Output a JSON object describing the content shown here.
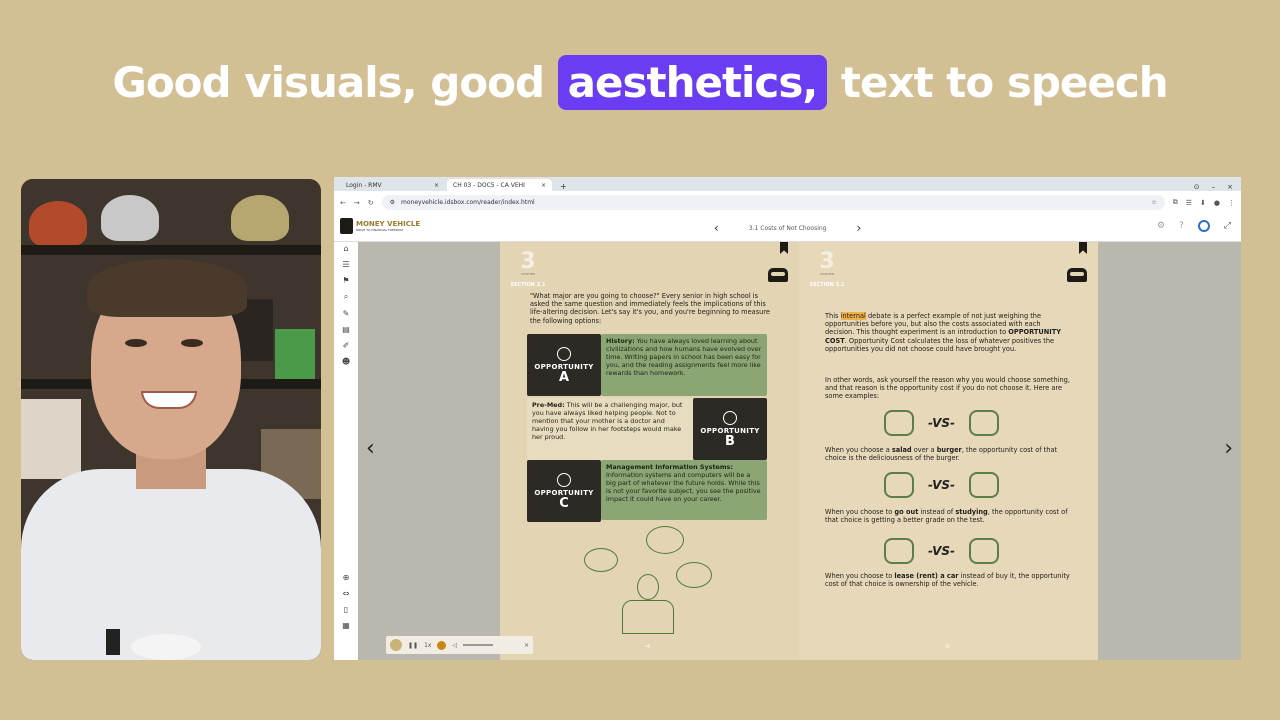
{
  "headline": {
    "pre": "Good visuals, good ",
    "highlight": "aesthetics,",
    "post": " text to speech"
  },
  "browser": {
    "tabs": [
      {
        "label": "Login - RMV",
        "close": "×"
      },
      {
        "label": "CH 03 - DOC5 - CA VEHI",
        "close": "×"
      }
    ],
    "new_tab": "+",
    "url": "moneyvehicle.idsbox.com/reader/index.html",
    "window_controls": [
      "⊙",
      "–",
      "×"
    ]
  },
  "app": {
    "brand_name": "MONEY VEHICLE",
    "brand_tagline": "DRIVE TO FINANCIAL FREEDOM",
    "chapter_title": "3.1 Costs of Not Choosing",
    "prev": "‹",
    "next": "›"
  },
  "sidebar_icons": [
    "home-icon",
    "list-icon",
    "bookmark-icon",
    "search-icon",
    "edit-icon",
    "highlight-icon",
    "pen-icon",
    "person-icon",
    "zoom-icon",
    "fit-icon",
    "page-icon",
    "grid-icon"
  ],
  "left_page": {
    "chapter_label": "CHAPTER",
    "chapter_num": "3",
    "section": "SECTION 3.1",
    "intro": "\"What major are you going to choose?\" Every senior in high school is asked the same question and immediately feels the implications of this life-altering decision. Let's say it's you, and you're beginning to measure the following options:",
    "opportunities": [
      {
        "word": "OPPORTUNITY",
        "letter": "A",
        "title": "History:",
        "text": " You have always loved learning about civilizations and how humans have evolved over time. Writing papers in school has been easy for you, and the reading assignments feel more like rewards than homework."
      },
      {
        "word": "OPPORTUNITY",
        "letter": "B",
        "title": "Pre-Med:",
        "text": " This will be a challenging major, but you have always liked helping people. Not to mention that your mother is a doctor and having you follow in her footsteps would make her proud."
      },
      {
        "word": "OPPORTUNITY",
        "letter": "C",
        "title": "Management Information Systems:",
        "text": " Information systems and computers will be a big part of whatever the future holds. While this is not your favorite subject, you see the positive impact it could have on your career."
      }
    ],
    "page_number": "-4-"
  },
  "right_page": {
    "chapter_label": "CHAPTER",
    "chapter_num": "3",
    "section": "SECTION 3.1",
    "p1_a": "This ",
    "p1_hl": "internal",
    "p1_b": " debate is a perfect example of not just weighing the opportunities before you, but also the costs associated with each decision. This thought experiment is an introduction to ",
    "p1_bold": "OPPORTUNITY COST",
    "p1_c": ". Opportunity Cost calculates the loss of whatever positives the opportunities you did not choose could have brought you.",
    "p2": "In other words, ask yourself the reason why you would choose something, and that reason is the opportunity cost if you do not choose it. Here are some examples:",
    "vs_label": "-VS-",
    "ex1_a": "When you choose a ",
    "ex1_b1": "salad",
    "ex1_mid": " over a ",
    "ex1_b2": "burger",
    "ex1_c": ", the opportunity cost of that choice is the deliciousness of the burger.",
    "ex2_a": "When you choose to ",
    "ex2_b1": "go out",
    "ex2_mid": " instead of ",
    "ex2_b2": "studying",
    "ex2_c": ", the opportunity cost of that choice is getting a better grade on the test.",
    "ex3_a": "When you choose to ",
    "ex3_b1": "lease (rent) a car",
    "ex3_c": " instead of buy it, the opportunity cost of that choice is ownership of the vehicle.",
    "page_number": "-5-"
  },
  "audio_player": {
    "speed": "1x",
    "close": "×"
  },
  "colors": {
    "accent": "#6b3df2",
    "background": "#d2bf94",
    "page": "#e3d4b3",
    "opportunity_green": "#8ba674"
  }
}
